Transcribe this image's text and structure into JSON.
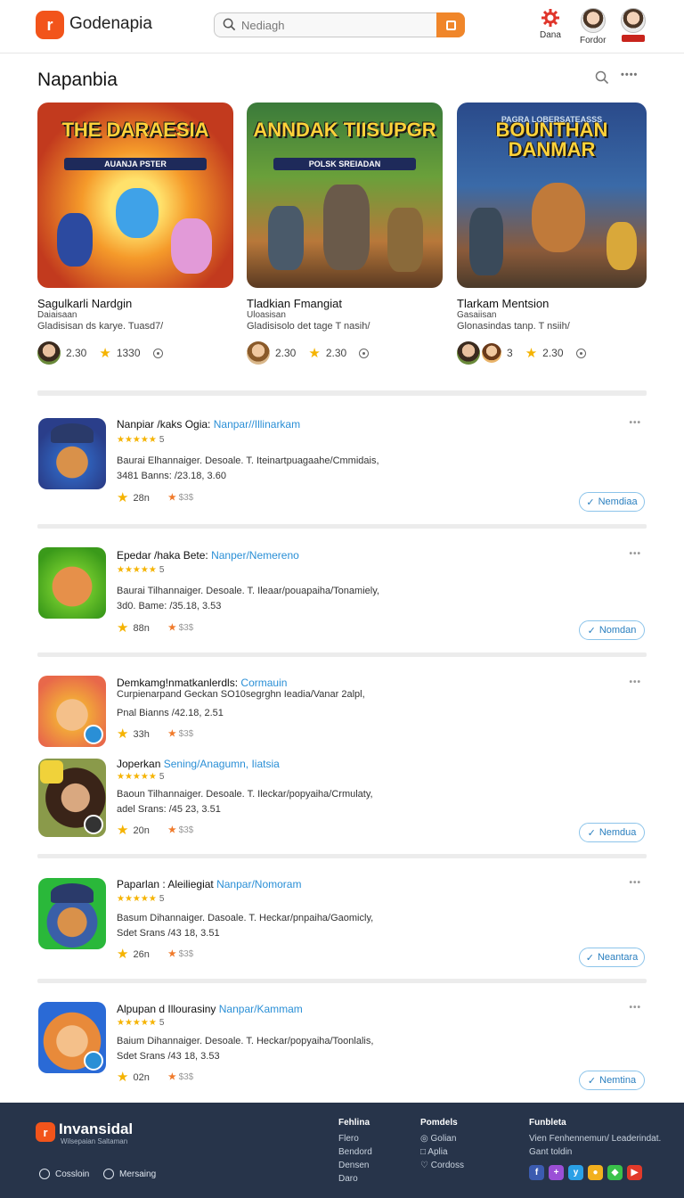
{
  "header": {
    "brand": "Godenapia",
    "search_placeholder": "Nediagh",
    "actions": [
      {
        "label": "Dana"
      },
      {
        "label": "Fordor"
      }
    ]
  },
  "section": {
    "title": "Napanbia",
    "more": "••••"
  },
  "featured": [
    {
      "art_title": "THE DARAESIA",
      "art_subtitle": "AUANJA PSTER",
      "title": "Sagulkarli Nardgin",
      "subtitle": "Daiaisaan",
      "desc": "Gladisisan ds karye. Tuasd7/",
      "views": "2.30",
      "rating": "1330"
    },
    {
      "art_title": "ANNDAK TIISUPGR",
      "art_subtitle": "POLSK SREIADAN",
      "title": "Tladkian Fmangiat",
      "subtitle": "Uloasisan",
      "desc": "Gladisisolo det tage T nasih/",
      "views": "2.30",
      "rating": "2.30"
    },
    {
      "art_title": "BOUNTHAN DANMAR",
      "art_subtitle": "PAGRA LOBERSATEASSS",
      "title": "Tlarkam Mentsion",
      "subtitle": "Gasaiisan",
      "desc": "Glonasindas tanp. T nsiih/",
      "views": "3",
      "rating": "2.30"
    }
  ],
  "list": [
    {
      "title": "Nanpiar /kaks Ogia:",
      "link": "Nanpar//Illinarkam",
      "rating": "★★★★★",
      "rating_num": "5",
      "desc": "Baurai Elhannaiger. Desoale. T. Iteinartpuagaahe/Cmmidais,",
      "stats": "3481 Banns: /23.18, 3.60",
      "likes": "28n",
      "price": "$3$",
      "button": "Nemdiaa"
    },
    {
      "title": "Epedar /haka Bete:",
      "link": "Nanper/Nemereno",
      "rating": "★★★★★",
      "rating_num": "5",
      "desc": "Baurai Tilhannaiger. Desoale. T. Ileaar/pouapaiha/Tonamiely,",
      "stats": "3d0. Bame: /35.18, 3.53",
      "likes": "88n",
      "price": "$3$",
      "button": "Nomdan"
    },
    {
      "title": "Demkamg!nmatkanlerdls:",
      "link": "Cormauin",
      "rating": "",
      "rating_num": "",
      "desc": "Curpienarpand Geckan SO10segrghn Ieadia/Vanar 2alpl,",
      "stats": "Pnal Bianns /42.18, 2.51",
      "likes": "33h",
      "price": "$3$",
      "button": ""
    },
    {
      "title": "Joperkan",
      "link": "Sening/Anagumn, Iiatsia",
      "rating": "★★★★★",
      "rating_num": "5",
      "desc": "Baoun Tilhannaiger. Desoale. T. Ileckar/popyaiha/Crmulaty,",
      "stats": "adel Srans: /45 23, 3.51",
      "likes": "20n",
      "price": "$3$",
      "button": "Nemdua"
    },
    {
      "title": "Paparlan : Aleiliegiat",
      "link": "Nanpar/Nomoram",
      "rating": "★★★★★",
      "rating_num": "5",
      "desc": "Basum Dihannaiger. Dasoale. T. Heckar/pnpaiha/Gaomicly,",
      "stats": "Sdet Srans /43 18, 3.51",
      "likes": "26n",
      "price": "$3$",
      "button": "Neantara"
    },
    {
      "title": "Alpupan d Illourasiny",
      "link": "Nanpar/Kammam",
      "rating": "★★★★★",
      "rating_num": "5",
      "desc": "Baium Dihannaiger. Desoale. T. Heckar/popyaiha/Toonlalis,",
      "stats": "Sdet Srans /43 18, 3.53",
      "likes": "02n",
      "price": "$3$",
      "button": "Nemtina"
    }
  ],
  "footer": {
    "brand": "Invansidal",
    "tagline": "Wilsepaian Saltaman",
    "links": [
      "Cossloin",
      "Mersaing"
    ],
    "col1": {
      "heading": "Fehlina",
      "items": [
        "Flero",
        "Bendord",
        "Densen",
        "Daro"
      ]
    },
    "col2": {
      "heading": "Pomdels",
      "items": [
        "Golian",
        "Aplia",
        "Cordoss"
      ]
    },
    "col3": {
      "heading": "Funbleta",
      "text1": "Vien Fenhennemun/ Leaderindat.",
      "text2": "Gant toldin"
    }
  },
  "colors": {
    "accent": "#f2541b",
    "search_button": "#f0862a",
    "link": "#2a8fd6",
    "star": "#f5b301",
    "footer_bg": "#27344a"
  }
}
